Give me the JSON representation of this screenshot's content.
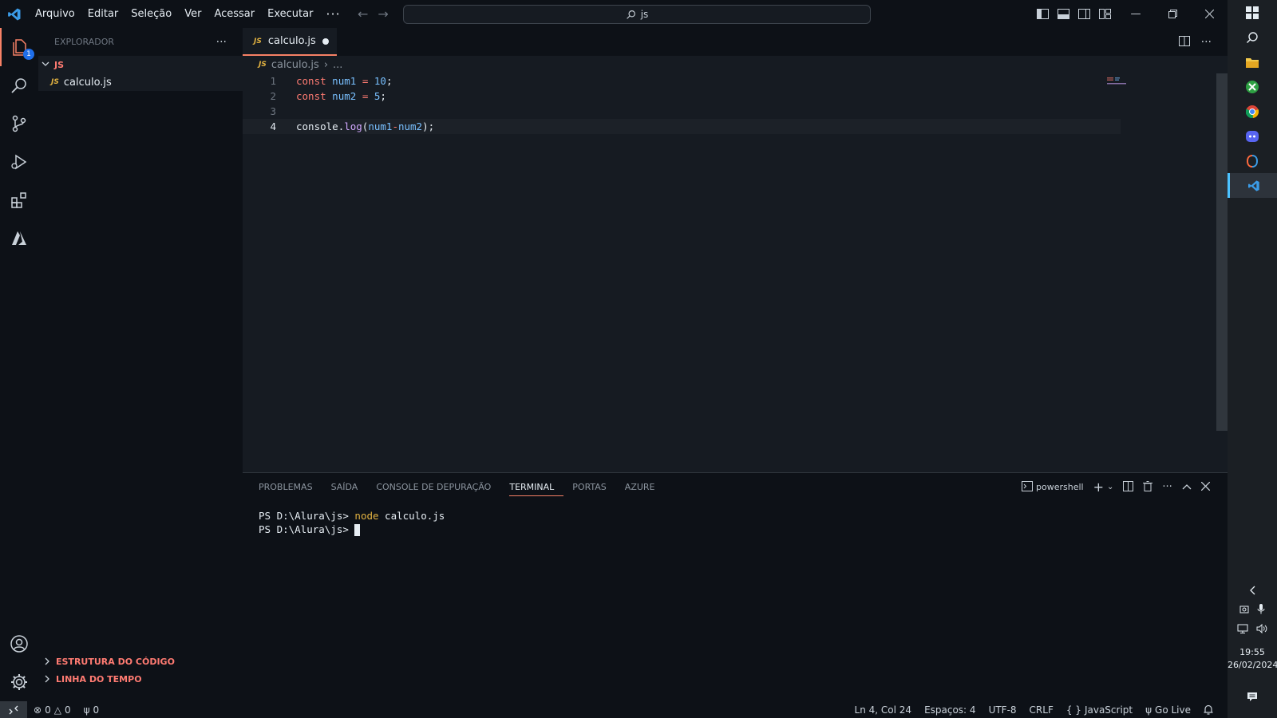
{
  "titlebar": {
    "menu": [
      "Arquivo",
      "Editar",
      "Seleção",
      "Ver",
      "Acessar",
      "Executar",
      "···"
    ],
    "search_text": "js"
  },
  "activity": {
    "explorer_badge": "1"
  },
  "sidebar": {
    "title": "EXPLORADOR",
    "more": "···",
    "folder": "JS",
    "files": [
      "calculo.js"
    ],
    "file_tag": "JS",
    "sections": [
      "ESTRUTURA DO CÓDIGO",
      "LINHA DO TEMPO"
    ]
  },
  "editor": {
    "tab_label": "calculo.js",
    "tab_tag": "JS",
    "breadcrumb": [
      "calculo.js",
      "..."
    ],
    "lines": [
      {
        "n": "1",
        "text": "const num1 = 10;"
      },
      {
        "n": "2",
        "text": "const num2 = 5;"
      },
      {
        "n": "3",
        "text": ""
      },
      {
        "n": "4",
        "text": "console.log(num1-num2);"
      }
    ]
  },
  "panel": {
    "tabs": [
      "PROBLEMAS",
      "SAÍDA",
      "CONSOLE DE DEPURAÇÃO",
      "TERMINAL",
      "PORTAS",
      "AZURE"
    ],
    "active_tab": "TERMINAL",
    "shell": "powershell",
    "terminal": [
      {
        "prompt": "PS D:\\Alura\\js> ",
        "cmd": "node",
        "args": " calculo.js"
      },
      {
        "prompt": "PS D:\\Alura\\js> ",
        "cmd": "",
        "args": ""
      }
    ]
  },
  "status": {
    "errors": "0",
    "warnings": "0",
    "ports": "0",
    "position": "Ln 4, Col 24",
    "spaces": "Espaços: 4",
    "encoding": "UTF-8",
    "eol": "CRLF",
    "language": "JavaScript",
    "golive": "Go Live"
  },
  "taskbar": {
    "time": "19:55",
    "date": "26/02/2024"
  },
  "colors": {
    "accent": "#f78166",
    "keyword": "#ff7b72",
    "variable": "#79c0ff",
    "function": "#d2a8ff",
    "folder_label": "#ff7b72"
  }
}
